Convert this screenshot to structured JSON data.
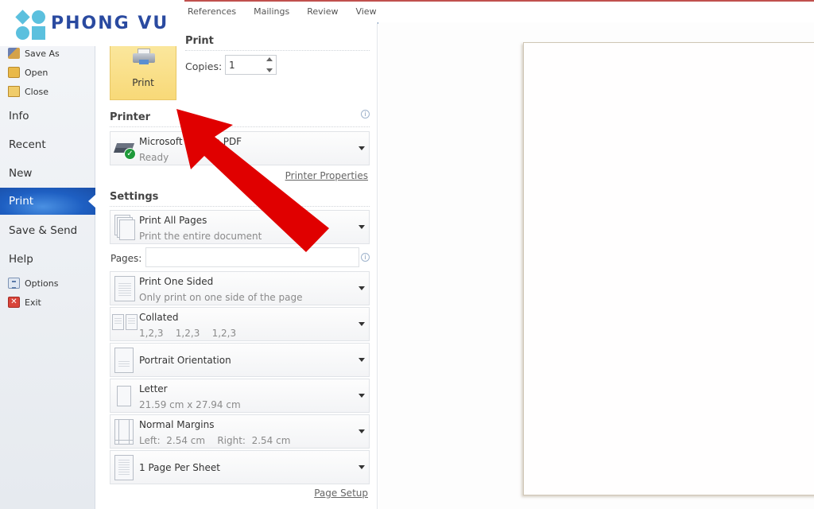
{
  "watermark": {
    "brand": "PHONG VU",
    "brand_color": "#2a4aa0",
    "mark_color": "#5bc0de"
  },
  "ribbon": {
    "tabs": [
      "References",
      "Mailings",
      "Review",
      "View"
    ]
  },
  "backstage_nav": {
    "top_items": [
      {
        "label": "Save As",
        "icon": "save-as-icon"
      },
      {
        "label": "Open",
        "icon": "folder-open-icon"
      },
      {
        "label": "Close",
        "icon": "folder-close-icon"
      }
    ],
    "main_items": [
      {
        "label": "Info",
        "active": false
      },
      {
        "label": "Recent",
        "active": false
      },
      {
        "label": "New",
        "active": false
      },
      {
        "label": "Print",
        "active": true
      },
      {
        "label": "Save & Send",
        "active": false
      },
      {
        "label": "Help",
        "active": false
      }
    ],
    "bottom_items": [
      {
        "label": "Options",
        "icon": "options-icon"
      },
      {
        "label": "Exit",
        "icon": "exit-icon"
      }
    ],
    "active_color": "#1e5fc2"
  },
  "print_panel": {
    "title": "Print",
    "print_button_label": "Print",
    "copies_label": "Copies:",
    "copies_value": "1",
    "printer_section": {
      "title": "Printer",
      "printer_name": "Microsoft Print to PDF",
      "printer_status": "Ready",
      "properties_link": "Printer Properties"
    },
    "settings_section": {
      "title": "Settings",
      "pages_label": "Pages:",
      "pages_value": "",
      "options": [
        {
          "main": "Print All Pages",
          "sub": "Print the entire document"
        },
        {
          "main": "Print One Sided",
          "sub": "Only print on one side of the page"
        },
        {
          "main": "Collated",
          "sub": "1,2,3    1,2,3    1,2,3"
        },
        {
          "main": "Portrait Orientation",
          "sub": ""
        },
        {
          "main": "Letter",
          "sub": "21.59 cm x 27.94 cm"
        },
        {
          "main": "Normal Margins",
          "sub": "Left:  2.54 cm    Right:  2.54 cm"
        },
        {
          "main": "1 Page Per Sheet",
          "sub": ""
        }
      ],
      "page_setup_link": "Page Setup"
    }
  },
  "annotation": {
    "type": "arrow",
    "color": "#e00000",
    "points_to": "print-button"
  }
}
